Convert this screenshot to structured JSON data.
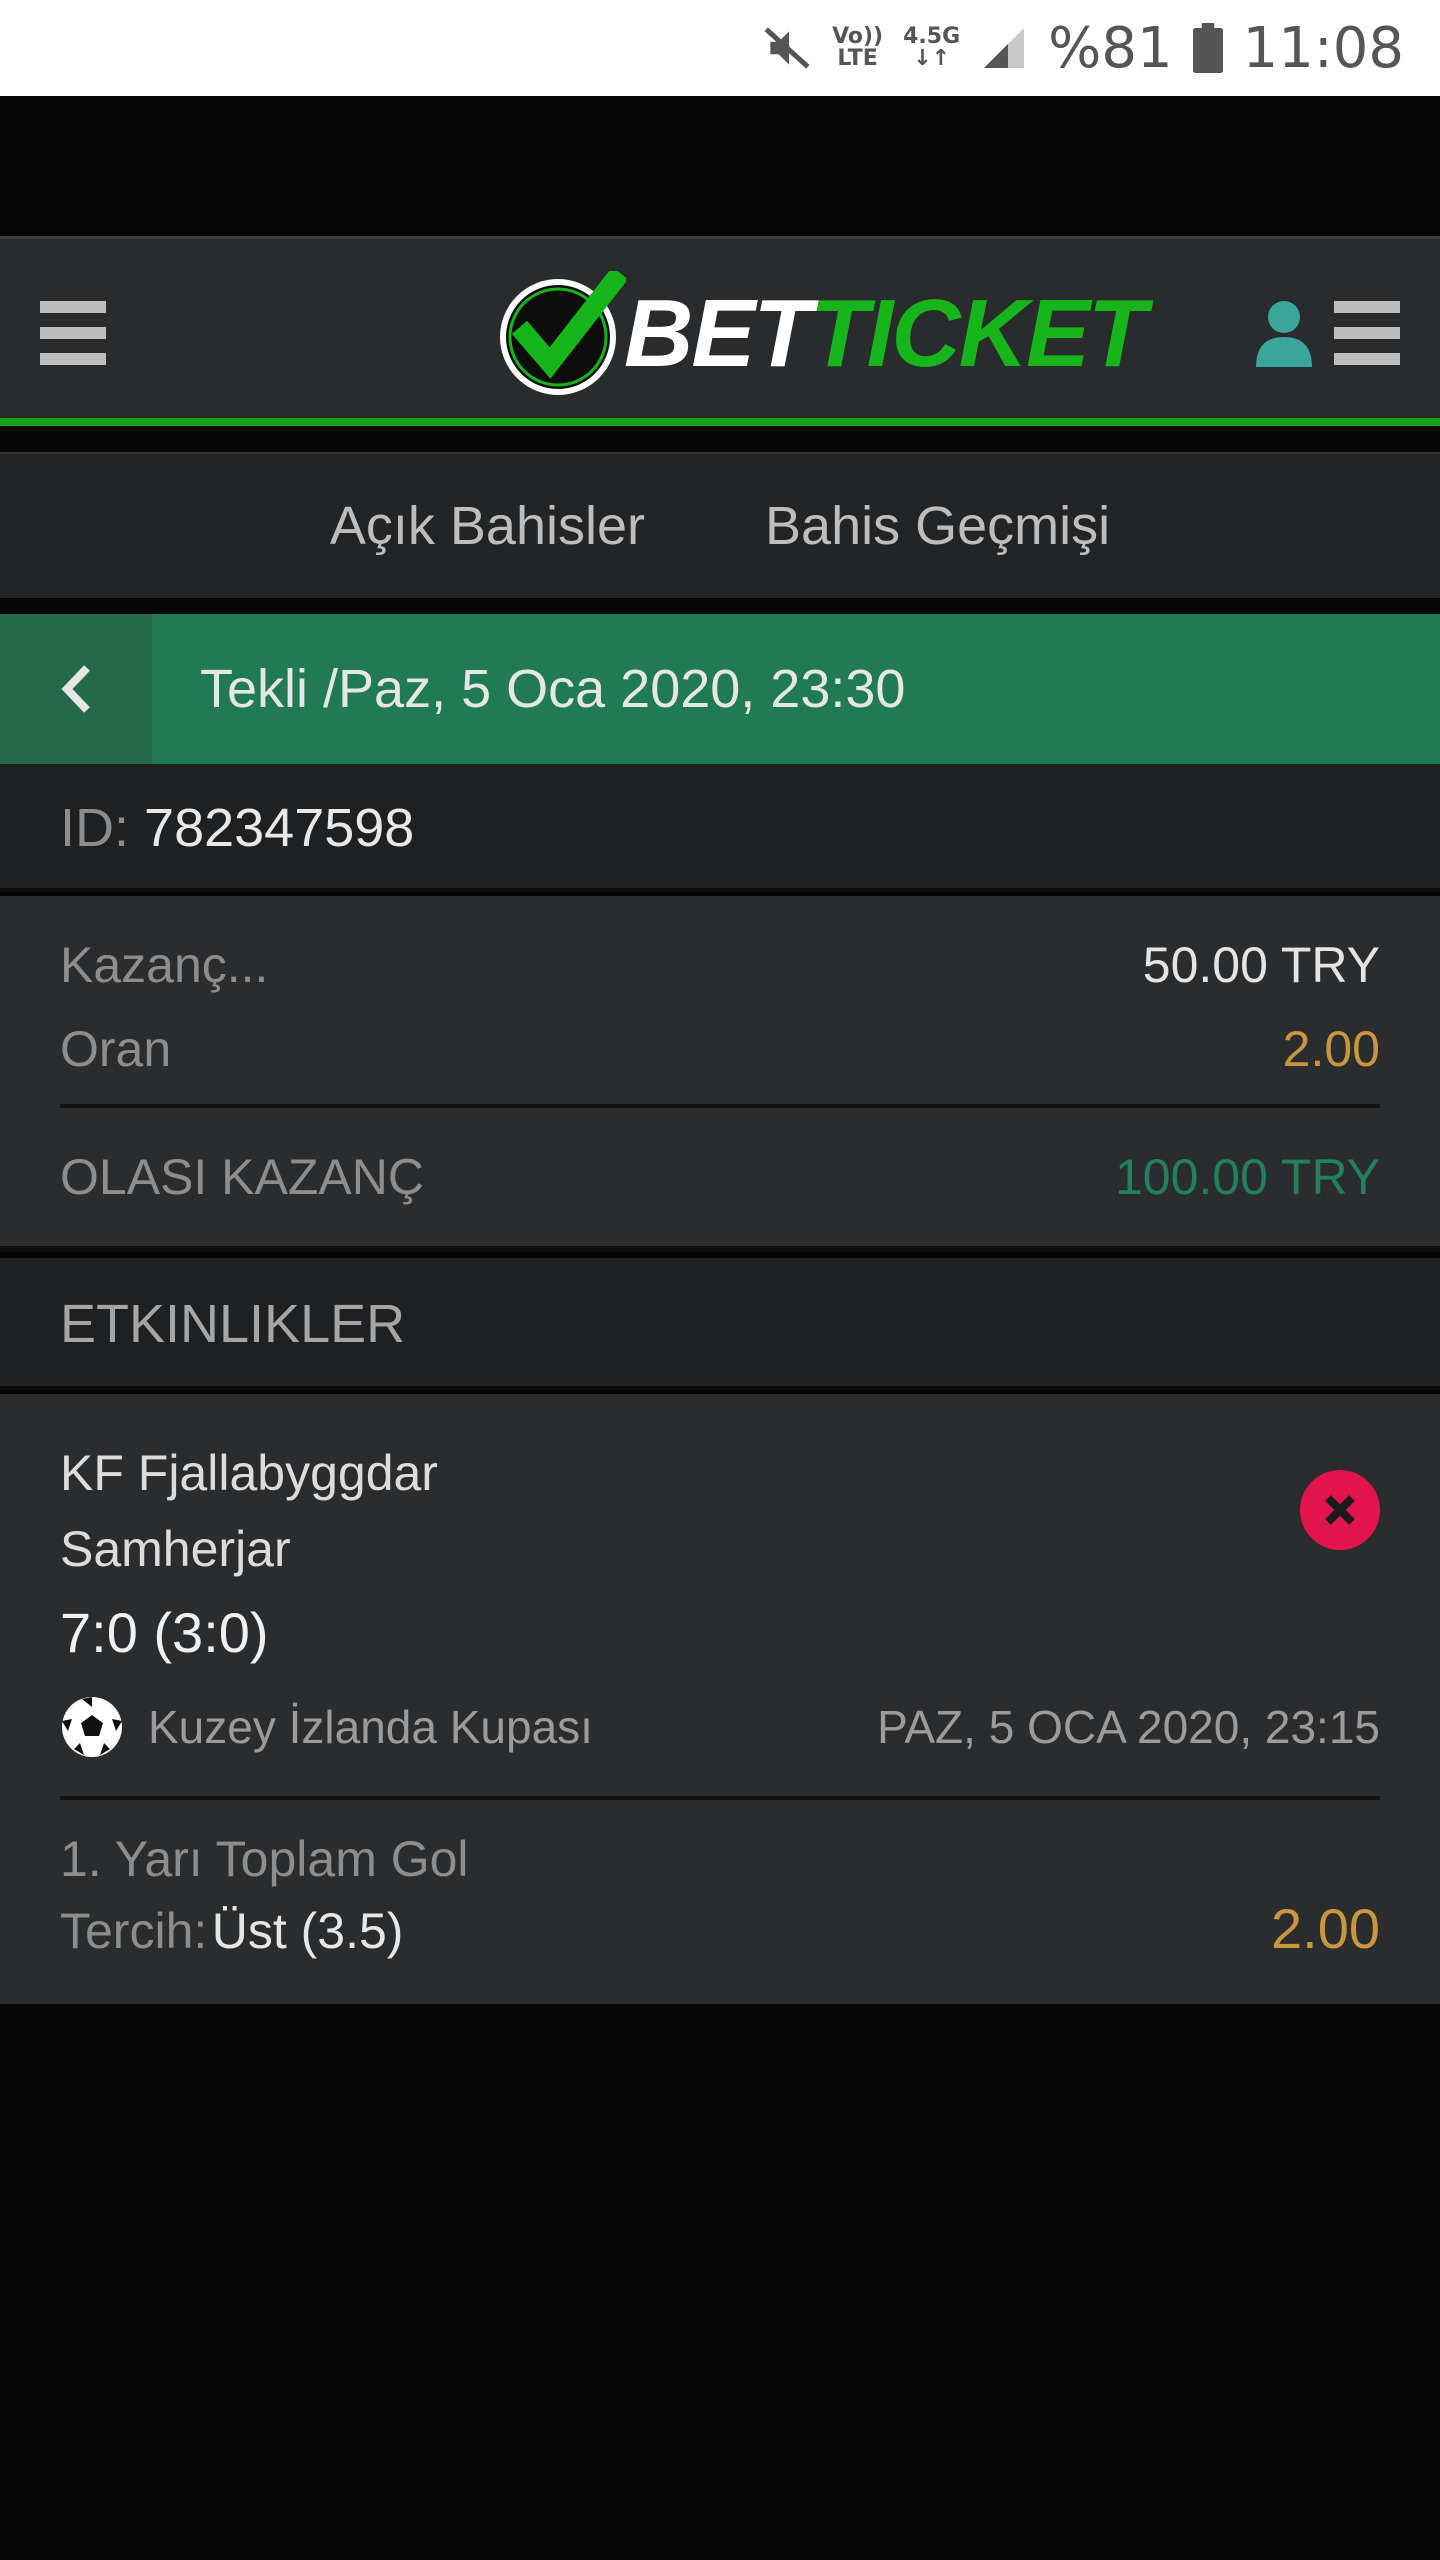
{
  "status_bar": {
    "lte_top": "Vo))",
    "lte_bottom": "LTE",
    "net_top": "4.5G",
    "net_bottom": "↓↑",
    "battery": "%81",
    "time": "11:08"
  },
  "header": {
    "logo_bet": "BET",
    "logo_ticket": "TICKET",
    "brand_green": "#17b51c",
    "bar_color": "#2a2b2d"
  },
  "tabs": [
    {
      "label": "Açık Bahisler"
    },
    {
      "label": "Bahis Geçmişi"
    }
  ],
  "bet": {
    "title": "Tekli /Paz, 5 Oca 2020, 23:30",
    "id_label": "ID:",
    "id_value": "782347598",
    "stake_label": "Kazanç...",
    "stake_value": "50.00 TRY",
    "odds_label": "Oran",
    "odds_value": "2.00",
    "potential_label": "OLASI KAZANÇ",
    "potential_value": "100.00 TRY"
  },
  "events": {
    "header": "ETKINLIKLER",
    "items": [
      {
        "home": "KF Fjallabyggdar",
        "away": "Samherjar",
        "score": "7:0 (3:0)",
        "league": "Kuzey İzlanda Kupası",
        "date": "PAZ, 5 OCA 2020, 23:15",
        "market": "1. Yarı Toplam Gol",
        "choice_label": "Tercih:",
        "choice_value": "Üst (3.5)",
        "odds": "2.00",
        "status_color": "#e3134f"
      }
    ]
  },
  "colors": {
    "green_header": "#1f7a55",
    "gold": "#c99640",
    "win_green": "#22805c"
  }
}
